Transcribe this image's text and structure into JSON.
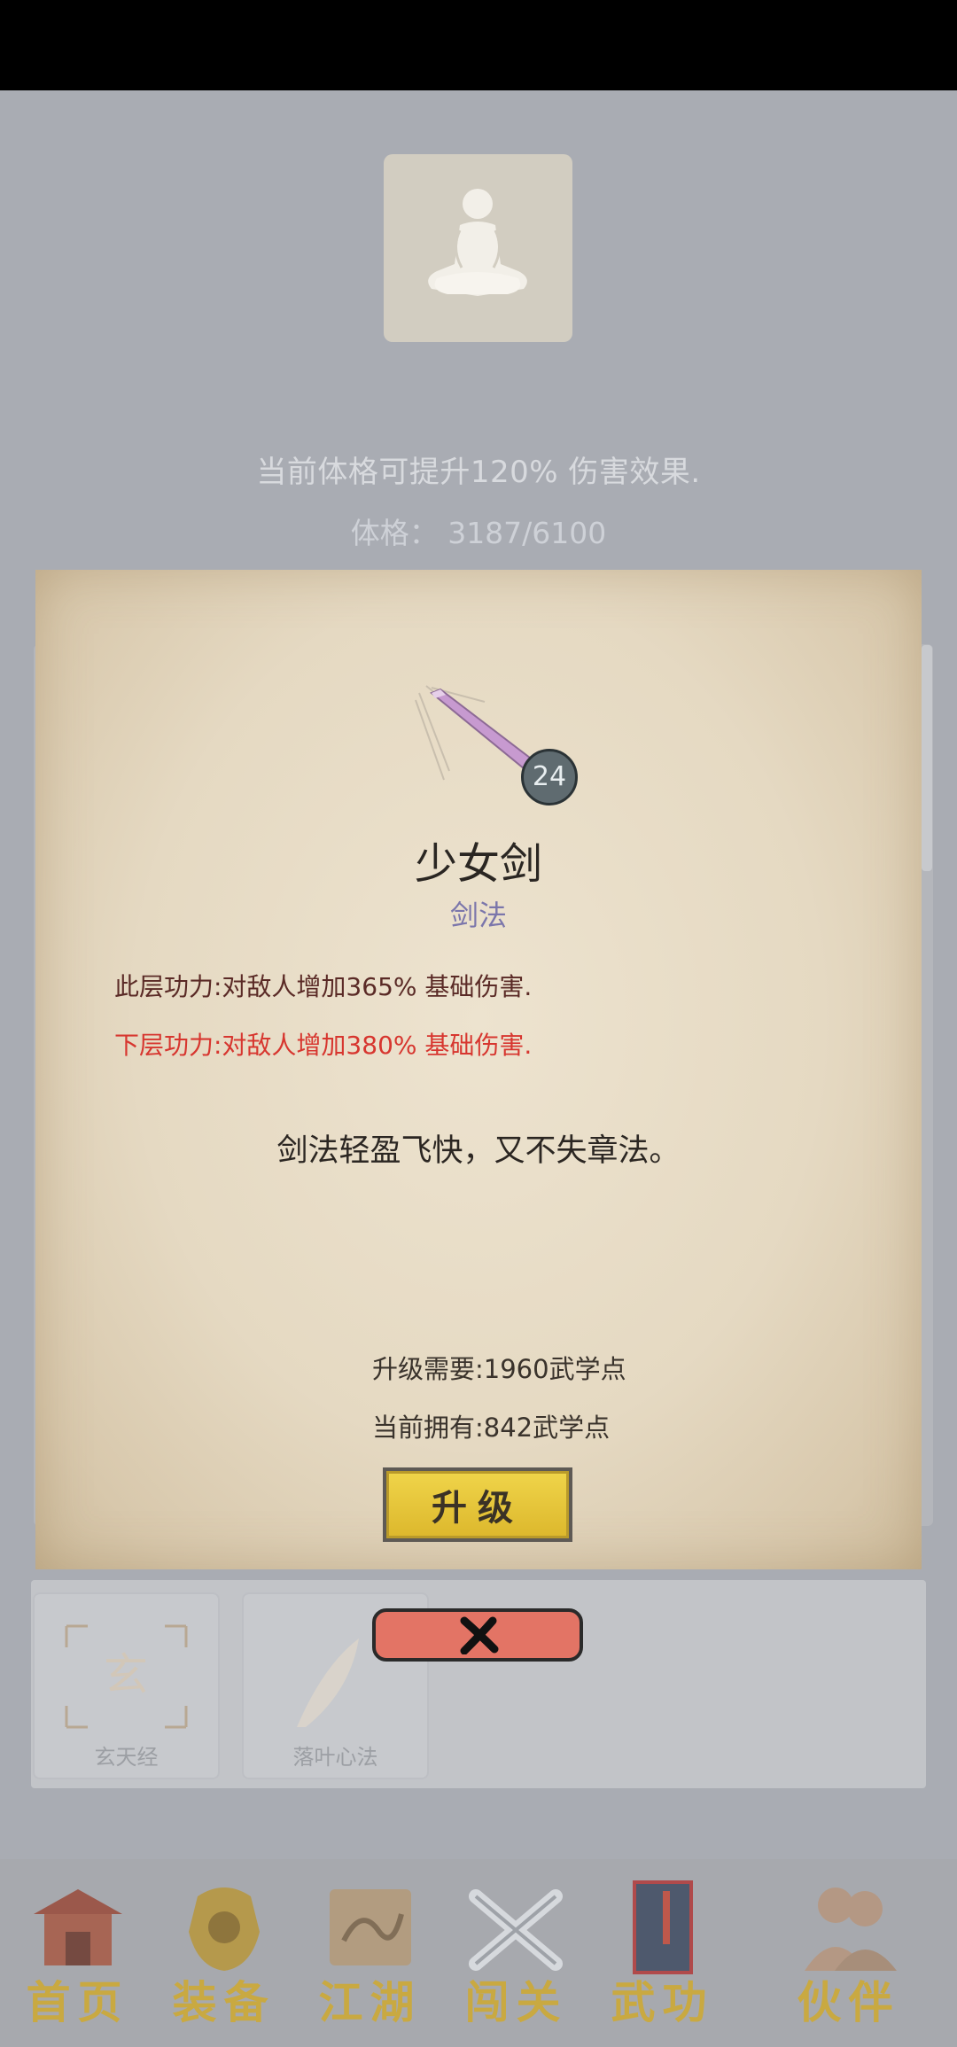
{
  "header": {
    "info_line": "当前体格可提升120% 伤害效果.",
    "stat_line": "体格： 3187/6100"
  },
  "dialog": {
    "level": "24",
    "skill_name": "少女剑",
    "skill_type": "剑法",
    "effect_current": "此层功力:对敌人增加365% 基础伤害.",
    "effect_next": "下层功力:对敌人增加380% 基础伤害.",
    "description": "剑法轻盈飞快，又不失章法。",
    "upgrade_cost": "升级需要:1960武学点",
    "current_points": "当前拥有:842武学点",
    "upgrade_label": "升级"
  },
  "skill_list": {
    "items": [
      {
        "label": "玄天经"
      },
      {
        "label": "落叶心法"
      }
    ]
  },
  "bottom_nav": {
    "items": [
      {
        "label": "首页",
        "icon": "temple-icon"
      },
      {
        "label": "装备",
        "icon": "armor-icon"
      },
      {
        "label": "江湖",
        "icon": "scroll-map-icon"
      },
      {
        "label": "闯关",
        "icon": "crossed-swords-icon"
      },
      {
        "label": "武功",
        "icon": "book-icon"
      },
      {
        "label": "伙伴",
        "icon": "partners-icon"
      }
    ]
  },
  "colors": {
    "effect_current": "#5a2a26",
    "effect_next": "#d7362f",
    "skill_type": "#7b76ab",
    "upgrade_button": "#f0d54a",
    "close_button": "#e37465"
  }
}
